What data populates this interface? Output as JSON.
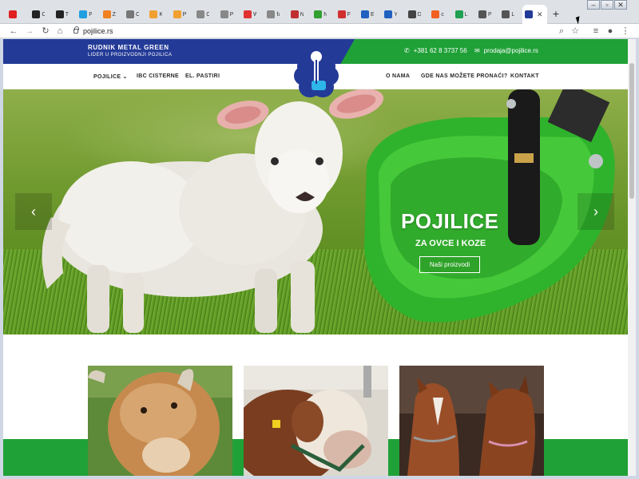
{
  "browser": {
    "tabs": [
      {
        "label": "",
        "color": "#e02020"
      },
      {
        "label": "O",
        "color": "#222222"
      },
      {
        "label": "Th",
        "color": "#222222"
      },
      {
        "label": "Pl",
        "color": "#20a0e0"
      },
      {
        "label": "Za",
        "color": "#f08020"
      },
      {
        "label": "C:",
        "color": "#777777"
      },
      {
        "label": "Ki",
        "color": "#f0a030"
      },
      {
        "label": "Pi",
        "color": "#f0a030"
      },
      {
        "label": "C",
        "color": "#888888"
      },
      {
        "label": "P:",
        "color": "#888888"
      },
      {
        "label": "W",
        "color": "#e03030"
      },
      {
        "label": "fa",
        "color": "#888888"
      },
      {
        "label": "N",
        "color": "#c03030"
      },
      {
        "label": "N",
        "color": "#30a030"
      },
      {
        "label": "Fo",
        "color": "#d03030"
      },
      {
        "label": "Ea",
        "color": "#2060c0"
      },
      {
        "label": "Yc",
        "color": "#2060c0"
      },
      {
        "label": "D",
        "color": "#444444"
      },
      {
        "label": "cl",
        "color": "#f06020"
      },
      {
        "label": "Li",
        "color": "#20a050"
      },
      {
        "label": "Pi",
        "color": "#555555"
      },
      {
        "label": "Lc",
        "color": "#555555"
      }
    ],
    "active_tab_color": "#233a97",
    "new_tab_label": "+",
    "url": "pojilice.rs"
  },
  "site": {
    "brand_name": "RUDNIK METAL GREEN",
    "brand_tagline": "LIDER U PROIZVODNJI POJILICA",
    "phone": "+381 62 8 3737 56",
    "email": "prodaja@pojilice.rs",
    "colors": {
      "blue": "#233a97",
      "green": "#1fa137"
    },
    "nav_left": [
      "POJILICE",
      "IBC CISTERNE",
      "EL. PASTIRI"
    ],
    "nav_right": [
      "O NAMA",
      "GDE NAS MOŽETE PRONAĆI?",
      "KONTAKT"
    ]
  },
  "hero": {
    "title": "POJILICE",
    "subtitle": "ZA OVCE I KOZE",
    "button_label": "Naši proizvodi",
    "prev_label": "‹",
    "next_label": "›"
  },
  "products": [
    {
      "name": "cow",
      "icon": "cow-photo"
    },
    {
      "name": "bull",
      "icon": "bull-photo"
    },
    {
      "name": "horses",
      "icon": "horses-photo"
    }
  ]
}
